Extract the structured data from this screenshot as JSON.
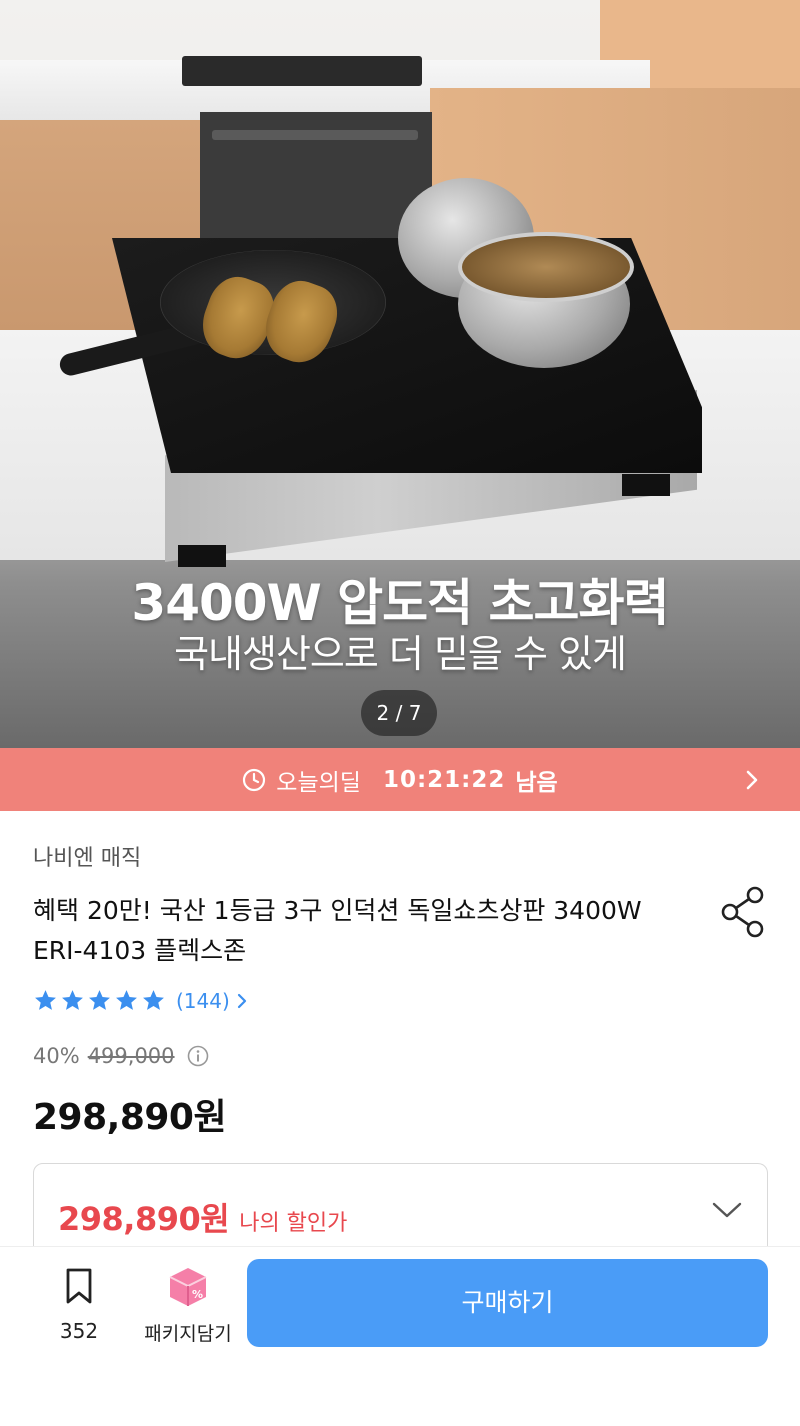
{
  "hero": {
    "headline": "3400W 압도적 초고화력",
    "subline": "국내생산으로 더 믿을 수 있게",
    "pager": "2 / 7"
  },
  "deal": {
    "label": "오늘의딜",
    "time": "10:21:22",
    "suffix": "남음",
    "icon": "clock-icon",
    "color": "#f0827a"
  },
  "product": {
    "brand": "나비엔 매직",
    "title": "혜택 20만! 국산 1등급 3구 인덕션 독일쇼츠상판 3400W ERI-4103 플렉스존",
    "rating": {
      "stars": 5,
      "review_count": "(144)"
    },
    "discount_rate": "40%",
    "original_price": "499,000",
    "price": "298,890원"
  },
  "my_price": {
    "value": "298,890원",
    "label": "나의 할인가",
    "color": "#e8484e"
  },
  "bottom_bar": {
    "bookmark_count": "352",
    "package_label": "패키지담기",
    "buy_label": "구매하기",
    "buy_color": "#4a9cf7"
  }
}
